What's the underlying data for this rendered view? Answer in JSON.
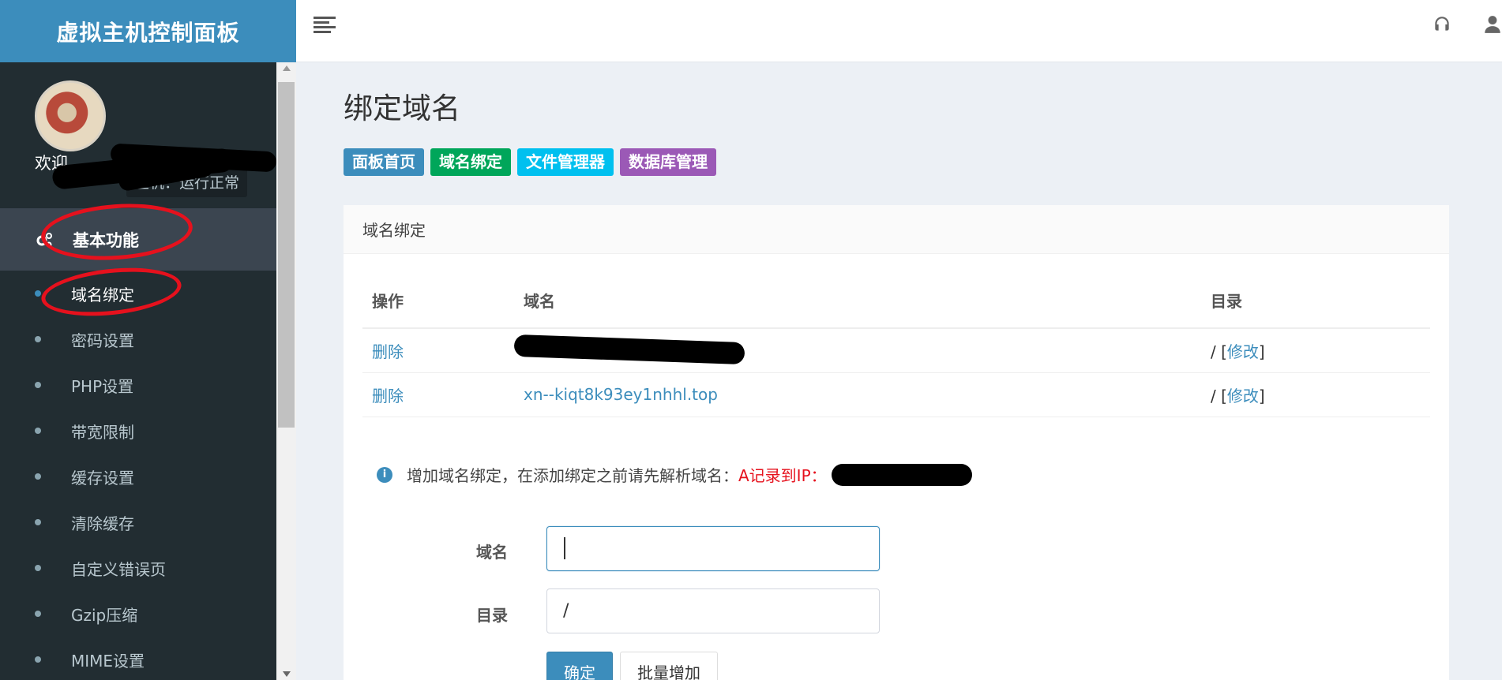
{
  "app": {
    "brand": "虚拟主机控制面板"
  },
  "sidebar": {
    "welcome": "欢迎",
    "status": "主机：运行正常",
    "section_title": "基本功能",
    "items": [
      {
        "label": "域名绑定",
        "active": true
      },
      {
        "label": "密码设置"
      },
      {
        "label": "PHP设置"
      },
      {
        "label": "带宽限制"
      },
      {
        "label": "缓存设置"
      },
      {
        "label": "清除缓存"
      },
      {
        "label": "自定义错误页"
      },
      {
        "label": "Gzip压缩"
      },
      {
        "label": "MIME设置"
      }
    ]
  },
  "page": {
    "title": "绑定域名",
    "quick_links": [
      {
        "label": "面板首页",
        "color": "#3c8dbc"
      },
      {
        "label": "域名绑定",
        "color": "#00a65a"
      },
      {
        "label": "文件管理器",
        "color": "#00c0ef"
      },
      {
        "label": "数据库管理",
        "color": "#9b59b6"
      }
    ],
    "box_title": "域名绑定",
    "table": {
      "headers": [
        "操作",
        "域名",
        "目录"
      ],
      "rows": [
        {
          "action": "删除",
          "domain": "",
          "dir": "/",
          "modify": "修改"
        },
        {
          "action": "删除",
          "domain": "xn--kiqt8k93ey1nhhl.top",
          "dir": "/",
          "modify": "修改"
        }
      ]
    },
    "info": {
      "text": "增加域名绑定，在添加绑定之前请先解析域名：",
      "highlight": "A记录到IP："
    },
    "form": {
      "domain_label": "域名",
      "domain_value": "",
      "dir_label": "目录",
      "dir_value": "/",
      "submit": "确定",
      "batch": "批量增加"
    }
  }
}
